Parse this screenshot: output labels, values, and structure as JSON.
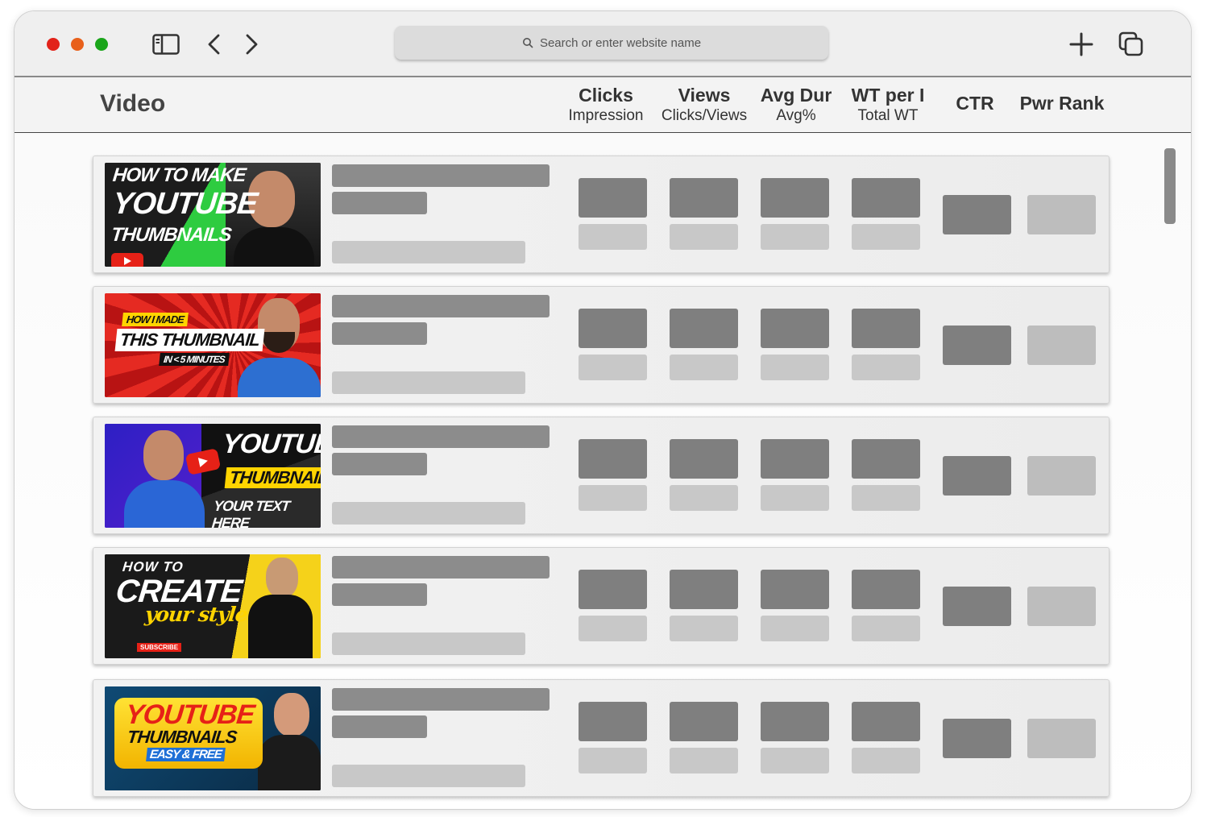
{
  "browser": {
    "url_placeholder": "Search or enter website name",
    "icons": [
      "sidebar-icon",
      "back-icon",
      "forward-icon",
      "plus-icon",
      "tabs-icon",
      "search-icon"
    ]
  },
  "header": {
    "title": "Video",
    "columns": [
      {
        "title": "Clicks",
        "subtitle": "Impression"
      },
      {
        "title": "Views",
        "subtitle": "Clicks/Views"
      },
      {
        "title": "Avg Dur",
        "subtitle": "Avg%"
      },
      {
        "title": "WT per I",
        "subtitle": "Total WT"
      },
      {
        "title": "CTR",
        "subtitle": ""
      },
      {
        "title": "Pwr Rank",
        "subtitle": ""
      }
    ]
  },
  "rows": [
    {
      "thumb": {
        "lines": [
          "HOW TO MAKE",
          "YOUTUBE",
          "THUMBNAILS"
        ],
        "bg": "#1c1c1c",
        "accent": "#2ecc40"
      }
    },
    {
      "thumb": {
        "lines": [
          "HOW I MADE",
          "THIS THUMBNAIL",
          "IN < 5 MINUTES"
        ],
        "bg": "#d91a1a",
        "accent": "#ffd400"
      }
    },
    {
      "thumb": {
        "lines": [
          "YOUTUBE",
          "THUMBNAIL",
          "YOUR TEXT HERE"
        ],
        "bg": "#3b1fd1",
        "accent": "#ffd400"
      }
    },
    {
      "thumb": {
        "lines": [
          "HOW TO",
          "CREATE",
          "your style",
          "SUBSCRIBE"
        ],
        "bg": "#1a1a1a",
        "accent": "#ffd400"
      }
    },
    {
      "thumb": {
        "lines": [
          "YOUTUBE",
          "THUMBNAILS",
          "EASY & FREE"
        ],
        "bg": "#0e3a5c",
        "accent": "#ffd400"
      }
    }
  ]
}
